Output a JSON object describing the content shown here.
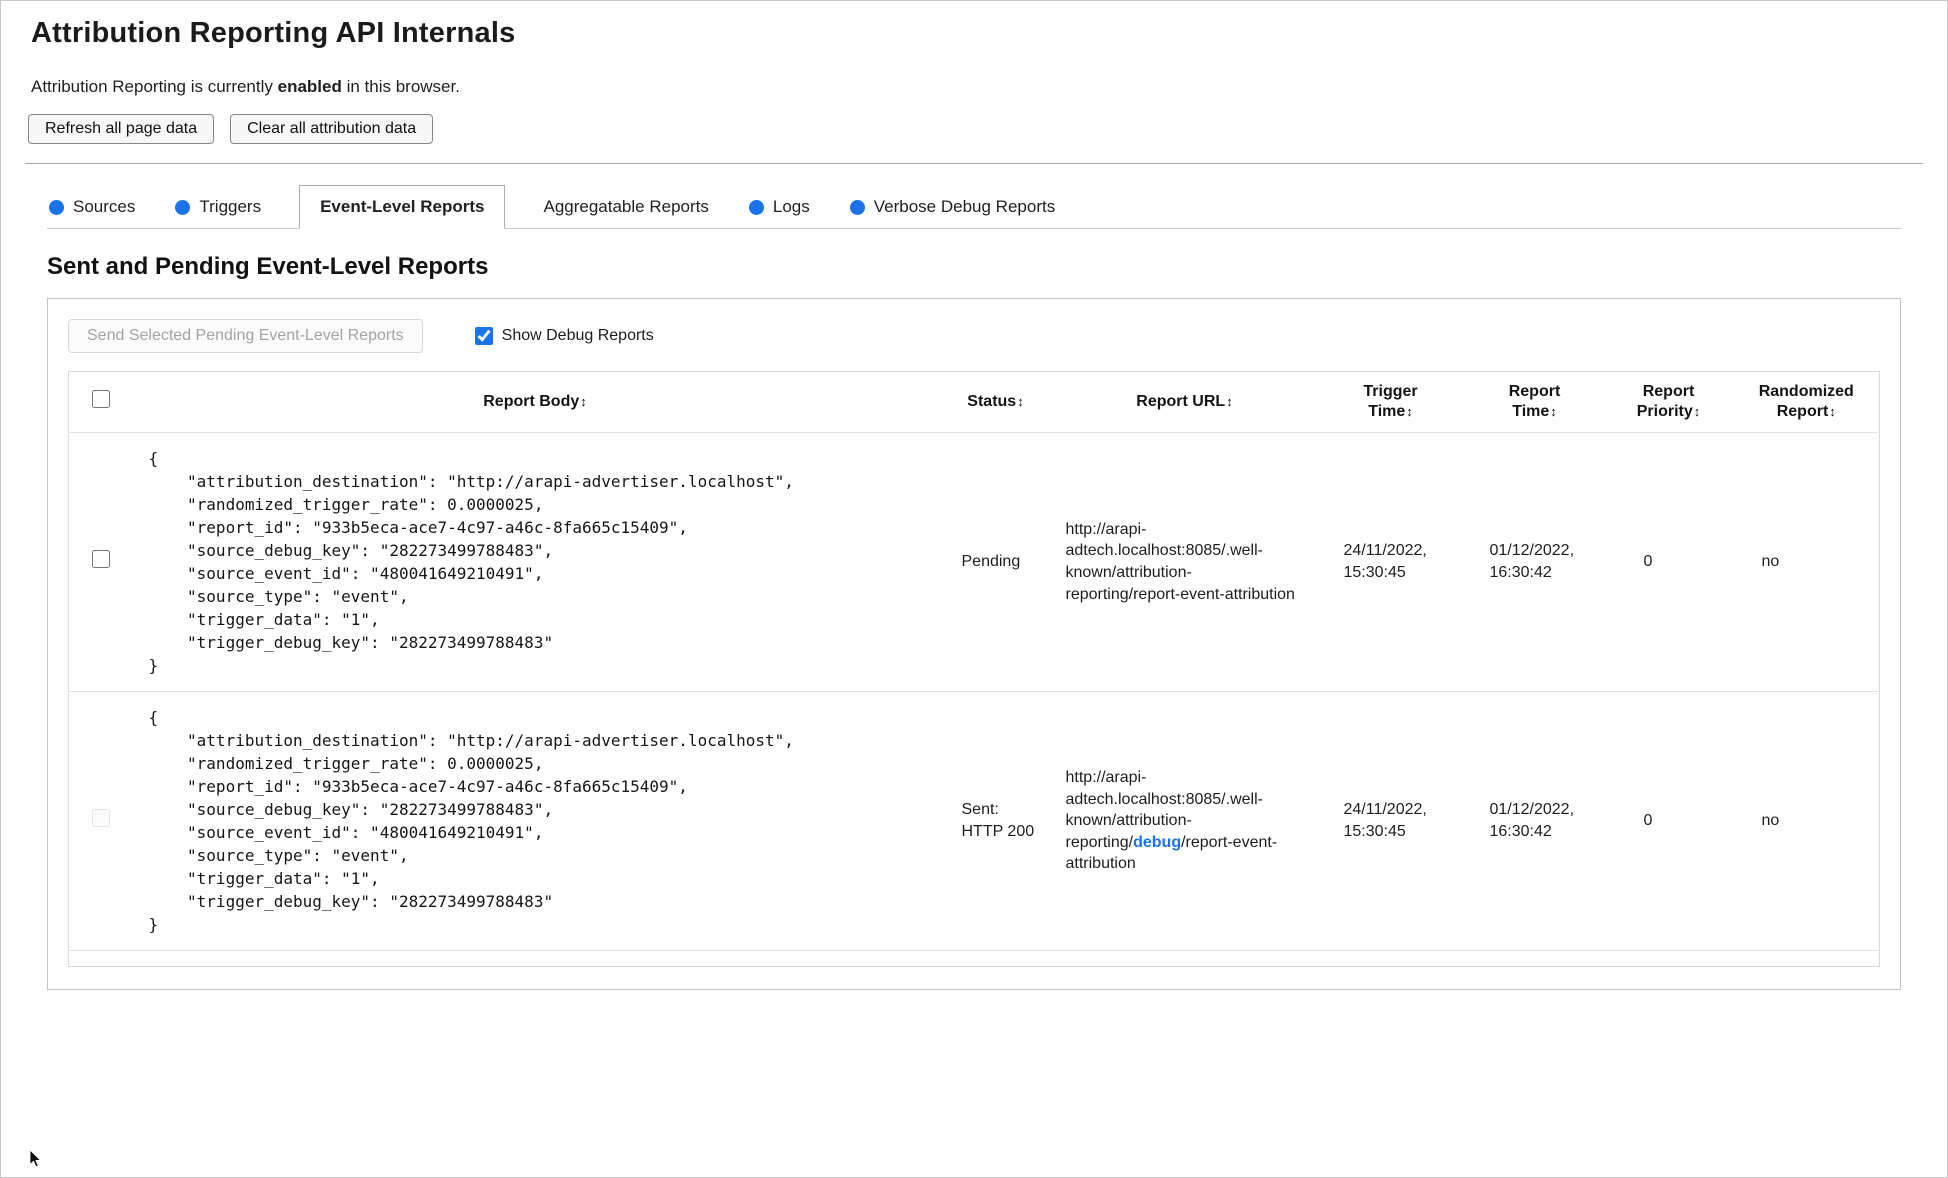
{
  "page": {
    "title": "Attribution Reporting API Internals",
    "status": {
      "prefix": "Attribution Reporting is currently ",
      "emphasis": "enabled",
      "suffix": " in this browser."
    },
    "buttons": {
      "refresh": "Refresh all page data",
      "clear": "Clear all attribution data"
    }
  },
  "tabs": [
    {
      "label": "Sources",
      "has_dot": true,
      "active": false
    },
    {
      "label": "Triggers",
      "has_dot": true,
      "active": false
    },
    {
      "label": "Event-Level Reports",
      "has_dot": false,
      "active": true
    },
    {
      "label": "Aggregatable Reports",
      "has_dot": false,
      "active": false
    },
    {
      "label": "Logs",
      "has_dot": true,
      "active": false
    },
    {
      "label": "Verbose Debug Reports",
      "has_dot": true,
      "active": false
    }
  ],
  "section": {
    "heading": "Sent and Pending Event-Level Reports",
    "send_button": "Send Selected Pending Event-Level Reports",
    "show_debug_label": "Show Debug Reports",
    "show_debug_checked": true
  },
  "report_table": {
    "sort_icon": "↕",
    "headers": {
      "report_body": "Report Body",
      "status": "Status",
      "report_url": "Report URL",
      "trigger_time": "Trigger Time",
      "report_time": "Report Time",
      "report_priority": "Report Priority",
      "randomized_report": "Randomized Report"
    },
    "rows": [
      {
        "report_body": "{\n    \"attribution_destination\": \"http://arapi-advertiser.localhost\",\n    \"randomized_trigger_rate\": 0.0000025,\n    \"report_id\": \"933b5eca-ace7-4c97-a46c-8fa665c15409\",\n    \"source_debug_key\": \"282273499788483\",\n    \"source_event_id\": \"480041649210491\",\n    \"source_type\": \"event\",\n    \"trigger_data\": \"1\",\n    \"trigger_debug_key\": \"282273499788483\"\n}",
        "status": "Pending",
        "url_pre": "http://arapi-adtech.localhost:8085/.well-known/attribution-reporting/report-event-attribution",
        "url_debug": "",
        "url_post": "",
        "trigger_time": "24/11/2022, 15:30:45",
        "report_time": "01/12/2022, 16:30:42",
        "report_priority": "0",
        "randomized_report": "no"
      },
      {
        "report_body": "{\n    \"attribution_destination\": \"http://arapi-advertiser.localhost\",\n    \"randomized_trigger_rate\": 0.0000025,\n    \"report_id\": \"933b5eca-ace7-4c97-a46c-8fa665c15409\",\n    \"source_debug_key\": \"282273499788483\",\n    \"source_event_id\": \"480041649210491\",\n    \"source_type\": \"event\",\n    \"trigger_data\": \"1\",\n    \"trigger_debug_key\": \"282273499788483\"\n}",
        "status": "Sent: HTTP 200",
        "url_pre": "http://arapi-adtech.localhost:8085/.well-known/attribution-reporting/",
        "url_debug": "debug",
        "url_post": "/report-event-attribution",
        "trigger_time": "24/11/2022, 15:30:45",
        "report_time": "01/12/2022, 16:30:42",
        "report_priority": "0",
        "randomized_report": "no"
      }
    ]
  },
  "colors": {
    "accent_blue": "#1a73e8",
    "debug_highlight": "#1a73e8"
  }
}
